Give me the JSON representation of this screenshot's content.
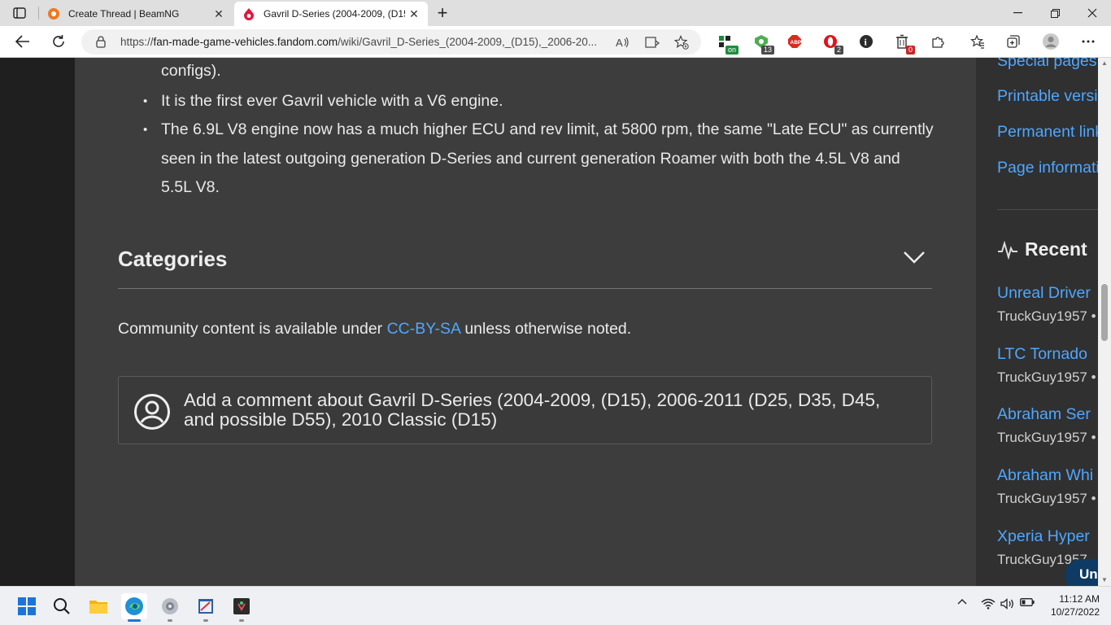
{
  "browser": {
    "tabs": [
      {
        "title": "Create Thread | BeamNG",
        "active": false
      },
      {
        "title": "Gavril D-Series (2004-2009, (D15",
        "active": true
      }
    ],
    "url_prefix": "https://",
    "url_host": "fan-made-game-vehicles.fandom.com",
    "url_path": "/wiki/Gavril_D-Series_(2004-2009,_(D15),_2006-20...",
    "extensions": [
      {
        "icon": "dock-extension-icon",
        "badge": "on",
        "badge_color": "#1e8e3e"
      },
      {
        "icon": "vpn-extension-icon",
        "badge": "13",
        "badge_color": "#3a3a3a"
      },
      {
        "icon": "adblock-icon",
        "badge": "",
        "badge_color": ""
      },
      {
        "icon": "opera-extension-icon",
        "badge": "2",
        "badge_color": "#3a3a3a"
      },
      {
        "icon": "info-extension-icon",
        "badge": "",
        "badge_color": ""
      },
      {
        "icon": "trash-extension-icon",
        "badge": "0",
        "badge_color": "#c62828"
      }
    ]
  },
  "article": {
    "fragment": "configs).",
    "bullets": [
      "It is the first ever Gavril vehicle with a V6 engine.",
      "The 6.9L V8 engine now has a much higher ECU and rev limit, at 5800 rpm, the same \"Late ECU\" as currently seen in the latest outgoing generation D-Series and current generation Roamer with both the 4.5L V8 and 5.5L V8."
    ],
    "bullet_char": "•"
  },
  "categories": {
    "title": "Categories"
  },
  "license": {
    "before": "Community content is available under ",
    "link": "CC-BY-SA",
    "after": " unless otherwise noted."
  },
  "comment": {
    "text": "Add a comment about Gavril D-Series (2004-2009, (D15), 2006-2011 (D25, D35, D45, and possible D55), 2010 Classic (D15)"
  },
  "rail": {
    "tools": [
      "Special pages",
      "Printable version",
      "Permanent link",
      "Page information"
    ],
    "recent_title": "Recent",
    "recent": [
      {
        "title": "Unreal Driver",
        "user": "TruckGuy1957 •"
      },
      {
        "title": "LTC Tornado",
        "user": "TruckGuy1957 •"
      },
      {
        "title": "Abraham Ser",
        "user": "TruckGuy1957 •"
      },
      {
        "title": "Abraham Whi",
        "user": "TruckGuy1957 •"
      },
      {
        "title": "Xperia Hyper",
        "user": "TruckGuy1957"
      }
    ],
    "floating_button": "Un"
  },
  "taskbar": {
    "time": "11:12 AM",
    "date": "10/27/2022"
  },
  "colors": {
    "link": "#4ea7ff",
    "page_bg": "#3d3d3d",
    "rail_bg": "#303030"
  }
}
